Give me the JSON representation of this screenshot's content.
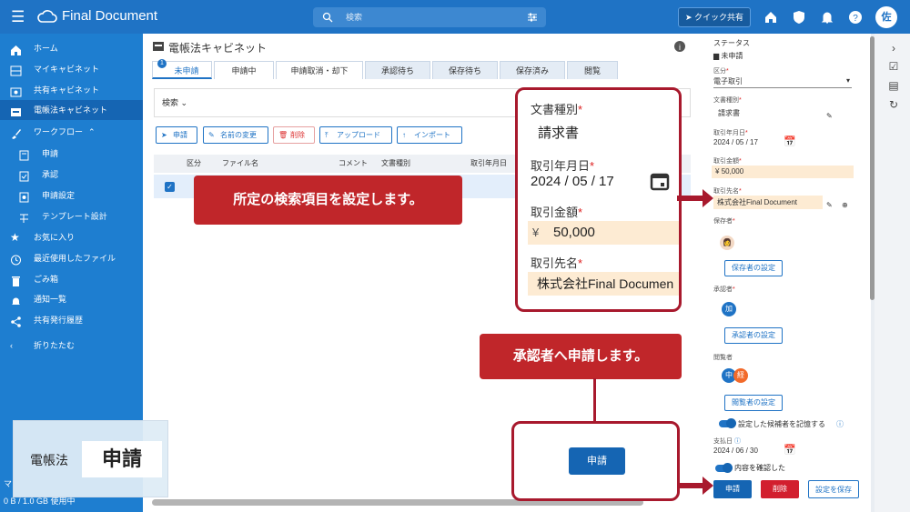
{
  "app": {
    "brand": "Final Document",
    "search_placeholder": "検索",
    "quick_share": "クイック共有",
    "user_initial": "佐"
  },
  "sidebar": {
    "items": [
      {
        "label": "ホーム",
        "icon": "home-icon"
      },
      {
        "label": "マイキャビネット",
        "icon": "cabinet-icon"
      },
      {
        "label": "共有キャビネット",
        "icon": "shared-cabinet-icon"
      },
      {
        "label": "電帳法キャビネット",
        "icon": "ledger-cabinet-icon"
      },
      {
        "label": "ワークフロー",
        "icon": "brush-icon"
      },
      {
        "label": "申請",
        "icon": "apply-icon"
      },
      {
        "label": "承認",
        "icon": "approve-icon"
      },
      {
        "label": "申請設定",
        "icon": "apply-setting-icon"
      },
      {
        "label": "テンプレート設計",
        "icon": "template-icon"
      },
      {
        "label": "お気に入り",
        "icon": "star-icon"
      },
      {
        "label": "最近使用したファイル",
        "icon": "clock-icon"
      },
      {
        "label": "ごみ箱",
        "icon": "trash-icon"
      },
      {
        "label": "通知一覧",
        "icon": "bell-icon"
      },
      {
        "label": "共有発行履歴",
        "icon": "share-icon"
      },
      {
        "label": "折りたたむ",
        "icon": "chevron-left-icon"
      }
    ],
    "storage_prefix": "マ",
    "storage": "0 B / 1.0 GB 使用中"
  },
  "main": {
    "title": "電帳法キャビネット",
    "tabs": [
      "未申請",
      "申請中",
      "申請取消・却下",
      "承認待ち",
      "保存待ち",
      "保存済み",
      "閲覧"
    ],
    "tab_badge": "1",
    "search_label": "検索",
    "actions": [
      "申請",
      "名前の変更",
      "削除",
      "アップロード",
      "インポート"
    ],
    "columns": [
      "区分",
      "ファイル名",
      "コメント",
      "文書種別",
      "取引年月日"
    ]
  },
  "right": {
    "status_label": "ステータス",
    "status_value": "未申請",
    "kubun_label": "区分",
    "kubun_value": "電子取引",
    "doc_type_label": "文書種別",
    "doc_type_value": "請求書",
    "date_label": "取引年月日",
    "date_value": "2024 / 05 / 17",
    "amount_label": "取引金額",
    "amount_currency": "¥",
    "amount_value": "50,000",
    "client_label": "取引先名",
    "client_value": "株式会社Final Document",
    "keeper_label": "保存者",
    "keeper_btn": "保存者の設定",
    "approver_label": "承認者",
    "approver_initial": "加",
    "approver_btn": "承認者の設定",
    "viewer_label": "閲覧者",
    "viewer_initials": [
      "中",
      "経"
    ],
    "viewer_btn": "閲覧者の設定",
    "remember_label": "設定した候補者を記憶する",
    "pay_label": "支払日",
    "pay_value": "2024 / 06 / 30",
    "confirm_label": "内容を確認した",
    "apply_btn": "申請",
    "delete_btn": "削除",
    "save_btn": "設定を保存"
  },
  "zoom": {
    "doc_type_label": "文書種別",
    "doc_type_value": "請求書",
    "date_label": "取引年月日",
    "date_value": "2024 / 05 / 17",
    "amount_label": "取引金額",
    "amount_currency": "¥",
    "amount_value": "50,000",
    "client_label": "取引先名",
    "client_value": "株式会社Final Documen"
  },
  "callouts": {
    "search": "所定の検索項目を設定します。",
    "approver": "承認者へ申請します。",
    "apply_button": "申請"
  },
  "badge": {
    "label": "電帳法",
    "action": "申請"
  },
  "colors": {
    "primary": "#1f73c5",
    "sidebar": "#1e7ed0",
    "callout": "#c0262a",
    "highlight": "#fdebd3"
  }
}
